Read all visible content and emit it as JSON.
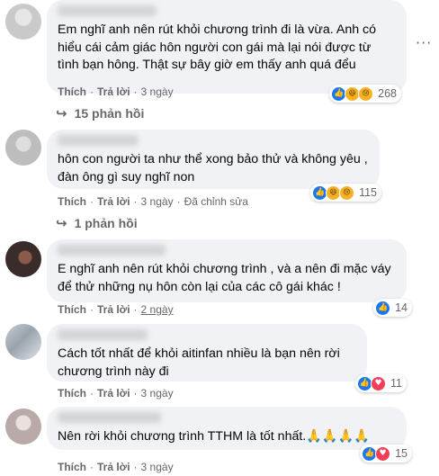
{
  "comments": [
    {
      "text": "Em nghĩ anh nên rút khỏi chương trình đi là vừa. Anh có\nhiểu cái cảm giác hôn người con gái mà lại nói được từ\ntình bạn hông. Thật sự bây giờ em thấy anh quá đểu",
      "reaction_count": "268",
      "like_label": "Thích",
      "reply_label": "Trả lời",
      "time": "3 ngày",
      "replies_label": "15 phản hồi"
    },
    {
      "text": "hôn con người ta như thể xong bảo thử và không yêu ,\nđàn ông gì suy nghĩ non",
      "reaction_count": "115",
      "like_label": "Thích",
      "reply_label": "Trả lời",
      "time": "3 ngày",
      "edited": "Đã chỉnh sửa",
      "replies_label": "1 phản hồi"
    },
    {
      "text": "E nghĩ anh nên rút khỏi chương trình , và a nên đi mặc váy\nđể thử những nụ hôn còn lại của các cô gái khác !",
      "reaction_count": "14",
      "like_label": "Thích",
      "reply_label": "Trả lời",
      "time": "2 ngày"
    },
    {
      "text": "Cách tốt nhất để khỏi aitinfan nhiều là bạn nên rời\nchương trình này đi",
      "reaction_count": "11",
      "like_label": "Thích",
      "reply_label": "Trả lời",
      "time": "3 ngày"
    },
    {
      "text": "Nên rời khỏi chương trình TTHM là tốt nhất.🙏🙏🙏🙏",
      "reaction_count": "15",
      "like_label": "Thích",
      "reply_label": "Trả lời",
      "time": "3 ngày"
    }
  ],
  "icons": {
    "like": "like-icon",
    "haha": "haha-icon",
    "sad": "sad-icon",
    "love": "love-icon",
    "reply_arrow": "reply-arrow-icon",
    "more": "more-options-icon"
  },
  "colors": {
    "bubble": "#f0f2f5",
    "meta_text": "#65676b",
    "like_blue": "#1877f2",
    "love_red": "#f33e58",
    "emoji_yellow": "#f7b125"
  }
}
